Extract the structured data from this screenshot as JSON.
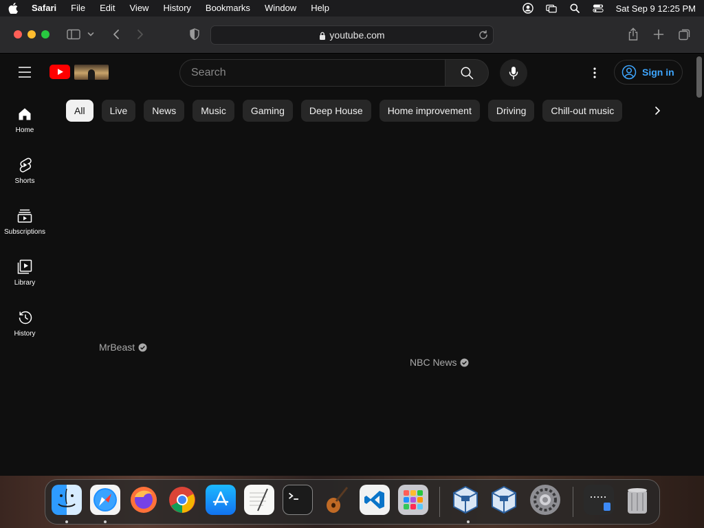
{
  "menubar": {
    "app_name": "Safari",
    "items": [
      "File",
      "Edit",
      "View",
      "History",
      "Bookmarks",
      "Window",
      "Help"
    ],
    "clock": "Sat Sep 9  12:25 PM",
    "status_icons": [
      "user-account-icon",
      "screen-mirroring-icon",
      "spotlight-search-icon",
      "control-center-icon"
    ]
  },
  "browser": {
    "url": "youtube.com",
    "toolbar_icons": [
      "sidebar-toggle-icon",
      "chevron-down-icon",
      "back-icon",
      "forward-icon",
      "privacy-shield-icon",
      "share-icon",
      "new-tab-icon",
      "tab-overview-icon"
    ]
  },
  "youtube": {
    "search": {
      "placeholder": "Search"
    },
    "sign_in_label": "Sign in",
    "accent_color": "#3ea6ff",
    "logo_color": "#ff0000",
    "guide": [
      {
        "label": "Home",
        "icon": "home-icon"
      },
      {
        "label": "Shorts",
        "icon": "shorts-icon"
      },
      {
        "label": "Subscriptions",
        "icon": "subscriptions-icon"
      },
      {
        "label": "Library",
        "icon": "library-icon"
      },
      {
        "label": "History",
        "icon": "history-icon"
      }
    ],
    "chips": [
      "All",
      "Live",
      "News",
      "Music",
      "Gaming",
      "Deep House",
      "Home improvement",
      "Driving",
      "Chill-out music"
    ],
    "active_chip": "All",
    "channels": [
      {
        "name": "MrBeast",
        "verified": true
      },
      {
        "name": "NBC News",
        "verified": true
      }
    ]
  },
  "dock": {
    "apps": [
      "Finder",
      "Safari",
      "Firefox",
      "Google Chrome",
      "App Store",
      "TextEdit",
      "Terminal",
      "GarageBand",
      "Visual Studio Code",
      "Launchpad",
      "VirtualBox",
      "VirtualBox VM",
      "System Settings",
      "Downloads",
      "Trash"
    ],
    "running": [
      "Finder",
      "Safari",
      "VirtualBox"
    ]
  }
}
